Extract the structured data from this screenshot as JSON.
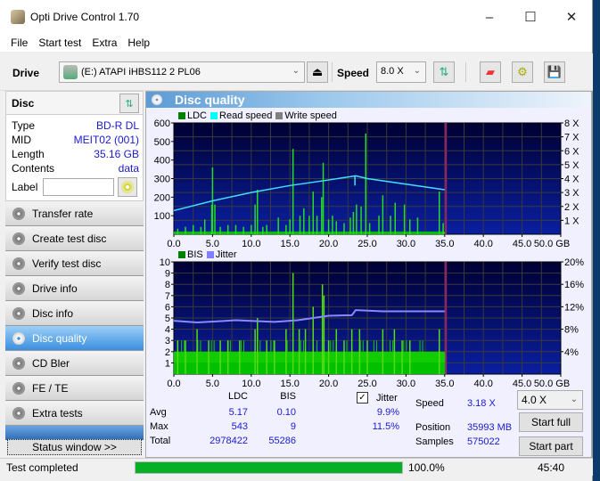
{
  "window": {
    "title": "Opti Drive Control 1.70",
    "minimize": "–",
    "maximize": "☐",
    "close": "✕"
  },
  "menu": [
    "File",
    "Start test",
    "Extra",
    "Help"
  ],
  "toolbar": {
    "drive_label": "Drive",
    "drive_value": "(E:)  ATAPI iHBS112  2 PL06",
    "speed_label": "Speed",
    "speed_value": "8.0 X"
  },
  "disc": {
    "header": "Disc",
    "rows": [
      {
        "label": "Type",
        "value": "BD-R DL"
      },
      {
        "label": "MID",
        "value": "MEIT02 (001)"
      },
      {
        "label": "Length",
        "value": "35.16 GB"
      },
      {
        "label": "Contents",
        "value": "data"
      }
    ],
    "label_field": "Label",
    "label_value": ""
  },
  "nav": [
    {
      "label": "Transfer rate",
      "active": false
    },
    {
      "label": "Create test disc",
      "active": false
    },
    {
      "label": "Verify test disc",
      "active": false
    },
    {
      "label": "Drive info",
      "active": false
    },
    {
      "label": "Disc info",
      "active": false
    },
    {
      "label": "Disc quality",
      "active": true
    },
    {
      "label": "CD Bler",
      "active": false
    },
    {
      "label": "FE / TE",
      "active": false
    },
    {
      "label": "Extra tests",
      "active": false
    }
  ],
  "status_window_button": "Status window >>",
  "panel_title": "Disc quality",
  "chart_data": [
    {
      "type": "bar",
      "title": "LDC / Read speed",
      "legend": [
        {
          "name": "LDC",
          "color": "#008000"
        },
        {
          "name": "Read speed",
          "color": "#00ffff"
        },
        {
          "name": "Write speed",
          "color": "#808080"
        }
      ],
      "legend_position": "top-left",
      "x_ticks": [
        "0.0",
        "5.0",
        "10.0",
        "15.0",
        "20.0",
        "25.0",
        "30.0",
        "35.0",
        "40.0",
        "45.0",
        "50.0 GB"
      ],
      "xlim": [
        0,
        50
      ],
      "ylim_left": [
        0,
        600
      ],
      "y_ticks_left": [
        "100",
        "200",
        "300",
        "400",
        "500",
        "600"
      ],
      "ylim_right": [
        0,
        8
      ],
      "y_ticks_right": [
        "1 X",
        "2 X",
        "3 X",
        "4 X",
        "5 X",
        "6 X",
        "7 X",
        "8 X"
      ],
      "end_marker_gb": 35.16,
      "ldc_baseline": 15,
      "ldc_spikes": [
        [
          0.5,
          30
        ],
        [
          1.5,
          40
        ],
        [
          2.5,
          50
        ],
        [
          3.5,
          40
        ],
        [
          4.0,
          80
        ],
        [
          4.9,
          160
        ],
        [
          5.0,
          360
        ],
        [
          5.3,
          160
        ],
        [
          6.0,
          40
        ],
        [
          7.0,
          50
        ],
        [
          8.0,
          50
        ],
        [
          9.0,
          40
        ],
        [
          10.0,
          50
        ],
        [
          10.5,
          160
        ],
        [
          10.8,
          240
        ],
        [
          11.5,
          40
        ],
        [
          12.0,
          50
        ],
        [
          13.5,
          90
        ],
        [
          14.5,
          50
        ],
        [
          15.0,
          80
        ],
        [
          15.4,
          460
        ],
        [
          16.3,
          100
        ],
        [
          16.8,
          140
        ],
        [
          17.5,
          100
        ],
        [
          18.0,
          230
        ],
        [
          18.5,
          100
        ],
        [
          19.1,
          200
        ],
        [
          19.3,
          385
        ],
        [
          20.0,
          80
        ],
        [
          20.5,
          100
        ],
        [
          21.0,
          70
        ],
        [
          22.0,
          60
        ],
        [
          22.8,
          90
        ],
        [
          23.2,
          120
        ],
        [
          23.6,
          160
        ],
        [
          24.2,
          150
        ],
        [
          24.8,
          543
        ],
        [
          25.3,
          60
        ],
        [
          26.5,
          100
        ],
        [
          27.0,
          210
        ],
        [
          28.0,
          100
        ],
        [
          28.6,
          170
        ],
        [
          29.8,
          160
        ],
        [
          30.5,
          80
        ],
        [
          31.5,
          90
        ],
        [
          34.3,
          230
        ],
        [
          34.8,
          60
        ]
      ],
      "read_speed_x": [
        [
          0,
          1.7
        ],
        [
          5,
          2.4
        ],
        [
          10,
          3.0
        ],
        [
          15,
          3.5
        ],
        [
          20,
          3.9
        ],
        [
          23.5,
          4.2
        ],
        [
          25,
          4.0
        ],
        [
          30,
          3.6
        ],
        [
          35,
          3.2
        ]
      ]
    },
    {
      "type": "bar",
      "title": "BIS / Jitter",
      "legend": [
        {
          "name": "BIS",
          "color": "#008000"
        },
        {
          "name": "Jitter",
          "color": "#8080ff"
        }
      ],
      "legend_position": "top-left",
      "x_ticks": [
        "0.0",
        "5.0",
        "10.0",
        "15.0",
        "20.0",
        "25.0",
        "30.0",
        "35.0",
        "40.0",
        "45.0",
        "50.0 GB"
      ],
      "xlim": [
        0,
        50
      ],
      "ylim_left": [
        0,
        10
      ],
      "y_ticks_left": [
        "1",
        "2",
        "3",
        "4",
        "5",
        "6",
        "7",
        "8",
        "9",
        "10"
      ],
      "ylim_right": [
        0,
        20
      ],
      "y_ticks_right": [
        "4%",
        "8%",
        "12%",
        "16%",
        "20%"
      ],
      "end_marker_gb": 35.16,
      "bis_baseline": 2,
      "bis_spikes": [
        [
          0.5,
          3
        ],
        [
          1.5,
          3
        ],
        [
          3.0,
          4
        ],
        [
          4.5,
          3
        ],
        [
          6,
          3
        ],
        [
          7,
          3
        ],
        [
          8.5,
          3
        ],
        [
          10.5,
          4
        ],
        [
          10.8,
          5
        ],
        [
          12,
          3
        ],
        [
          13,
          3
        ],
        [
          14.5,
          4
        ],
        [
          15.4,
          9
        ],
        [
          16.2,
          4
        ],
        [
          17,
          4
        ],
        [
          18,
          6
        ],
        [
          19.2,
          8
        ],
        [
          19.4,
          7
        ],
        [
          20,
          3
        ],
        [
          21,
          4
        ],
        [
          22,
          3
        ],
        [
          23,
          4
        ],
        [
          24,
          4
        ],
        [
          25,
          3
        ],
        [
          27,
          4
        ],
        [
          28.5,
          4
        ],
        [
          29.5,
          3
        ],
        [
          30.5,
          3
        ],
        [
          34.3,
          4
        ]
      ],
      "jitter_pct": [
        [
          0,
          9.5
        ],
        [
          3,
          9.2
        ],
        [
          8,
          9.6
        ],
        [
          13,
          9.3
        ],
        [
          16,
          9.6
        ],
        [
          18,
          10.0
        ],
        [
          20,
          10.4
        ],
        [
          23,
          10.5
        ],
        [
          23.5,
          11.4
        ],
        [
          27,
          11.2
        ],
        [
          35,
          11.2
        ]
      ]
    }
  ],
  "stats": {
    "col_ldc": "LDC",
    "col_bis": "BIS",
    "jitter_label": "Jitter",
    "jitter_checked": true,
    "rows": [
      {
        "label": "Avg",
        "ldc": "5.17",
        "bis": "0.10",
        "jitter": "9.9%"
      },
      {
        "label": "Max",
        "ldc": "543",
        "bis": "9",
        "jitter": "11.5%"
      },
      {
        "label": "Total",
        "ldc": "2978422",
        "bis": "55286",
        "jitter": ""
      }
    ],
    "speed_label": "Speed",
    "speed_value": "3.18 X",
    "position_label": "Position",
    "position_value": "35993 MB",
    "samples_label": "Samples",
    "samples_value": "575022",
    "speed_select": "4.0 X",
    "start_full": "Start full",
    "start_part": "Start part"
  },
  "statusbar": {
    "text": "Test completed",
    "progress": 100.0,
    "progress_text": "100.0%",
    "time": "45:40"
  }
}
